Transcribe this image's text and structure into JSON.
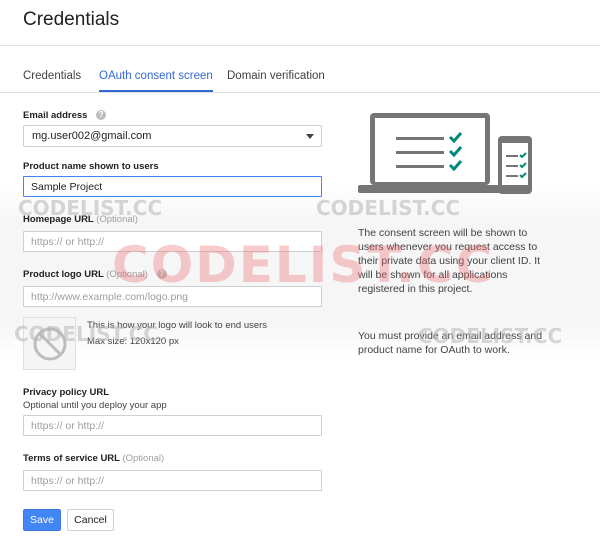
{
  "header": {
    "title": "Credentials"
  },
  "tabs": [
    {
      "label": "Credentials"
    },
    {
      "label": "OAuth consent screen",
      "active": true
    },
    {
      "label": "Domain verification"
    }
  ],
  "form": {
    "email": {
      "label": "Email address",
      "value": "mg.user002@gmail.com"
    },
    "product_name": {
      "label": "Product name shown to users",
      "value": "Sample Project"
    },
    "homepage": {
      "label": "Homepage URL",
      "optional": "(Optional)",
      "placeholder": "https:// or http://"
    },
    "logo_url": {
      "label": "Product logo URL",
      "optional": "(Optional)",
      "placeholder": "http://www.example.com/logo.png"
    },
    "logo_preview": {
      "line1": "This is how your logo will look to end users",
      "line2": "Max size: 120x120 px"
    },
    "privacy": {
      "label": "Privacy policy URL",
      "sublabel": "Optional until you deploy your app",
      "placeholder": "https:// or http://"
    },
    "terms": {
      "label": "Terms of service URL",
      "optional": "(Optional)",
      "placeholder": "https:// or http://"
    }
  },
  "buttons": {
    "save": "Save",
    "cancel": "Cancel"
  },
  "info": {
    "paragraph1": "The consent screen will be shown to users whenever you request access to their private data using your client ID. It will be shown for all applications registered in this project.",
    "paragraph2": "You must provide an email address and product name for OAuth to work."
  },
  "watermarks": {
    "small": "CODELIST.CC",
    "large": "CODELIST.CC"
  },
  "colors": {
    "accent": "#3367d6",
    "check": "#00897b",
    "device": "#757575",
    "primary_button": "#4285f4"
  }
}
